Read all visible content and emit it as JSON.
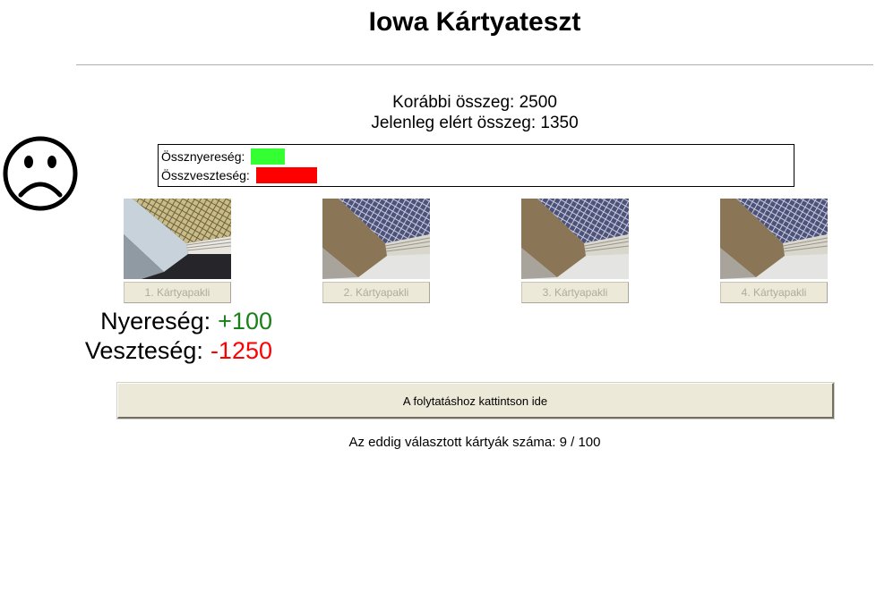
{
  "header": {
    "title": "Iowa Kártyateszt"
  },
  "totals": {
    "previous": "Korábbi összeg: 2500",
    "current": "Jelenleg elért összeg: 1350"
  },
  "summary": {
    "gain_label": "Össznyereség:",
    "loss_label": "Összveszteség:",
    "gain_color": "#33ff33",
    "loss_color": "#ff0000"
  },
  "decks": [
    {
      "label": "1. Kártyapakli",
      "back": "gold"
    },
    {
      "label": "2. Kártyapakli",
      "back": "blue"
    },
    {
      "label": "3. Kártyapakli",
      "back": "blue"
    },
    {
      "label": "4. Kártyapakli",
      "back": "blue"
    }
  ],
  "last_draw": {
    "gain_label": "Nyereség:",
    "gain_value": "+100",
    "loss_label": "Veszteség:",
    "loss_value": "-1250"
  },
  "continue_label": "A folytatáshoz kattintson ide",
  "counter": "Az eddig választott kártyák száma: 9 / 100",
  "icons": {
    "mood": "sad-face-icon"
  }
}
